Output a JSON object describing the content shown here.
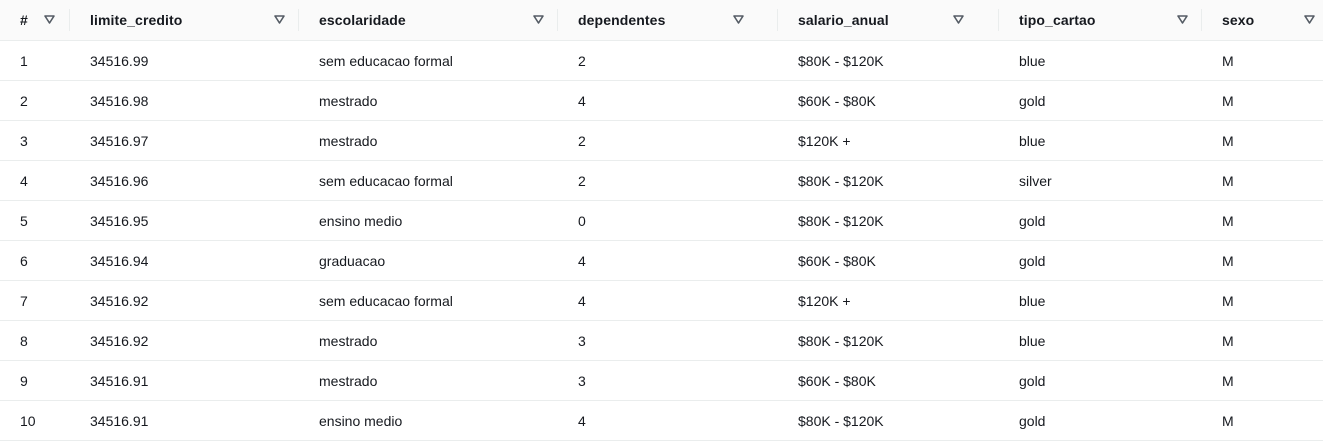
{
  "table": {
    "columns": [
      {
        "label": "#"
      },
      {
        "label": "limite_credito"
      },
      {
        "label": "escolaridade"
      },
      {
        "label": "dependentes"
      },
      {
        "label": "salario_anual"
      },
      {
        "label": "tipo_cartao"
      },
      {
        "label": "sexo"
      }
    ],
    "sort_icon": "caret-down-outline-icon",
    "rows": [
      [
        "1",
        "34516.99",
        "sem educacao formal",
        "2",
        "$80K - $120K",
        "blue",
        "M"
      ],
      [
        "2",
        "34516.98",
        "mestrado",
        "4",
        "$60K - $80K",
        "gold",
        "M"
      ],
      [
        "3",
        "34516.97",
        "mestrado",
        "2",
        "$120K +",
        "blue",
        "M"
      ],
      [
        "4",
        "34516.96",
        "sem educacao formal",
        "2",
        "$80K - $120K",
        "silver",
        "M"
      ],
      [
        "5",
        "34516.95",
        "ensino medio",
        "0",
        "$80K - $120K",
        "gold",
        "M"
      ],
      [
        "6",
        "34516.94",
        "graduacao",
        "4",
        "$60K - $80K",
        "gold",
        "M"
      ],
      [
        "7",
        "34516.92",
        "sem educacao formal",
        "4",
        "$120K +",
        "blue",
        "M"
      ],
      [
        "8",
        "34516.92",
        "mestrado",
        "3",
        "$80K - $120K",
        "blue",
        "M"
      ],
      [
        "9",
        "34516.91",
        "mestrado",
        "3",
        "$60K - $80K",
        "gold",
        "M"
      ],
      [
        "10",
        "34516.91",
        "ensino medio",
        "4",
        "$80K - $120K",
        "gold",
        "M"
      ]
    ]
  },
  "colors": {
    "header_bg": "#fafafa",
    "row_border": "#eaeded",
    "text": "#16191f",
    "icon": "#545b64"
  }
}
